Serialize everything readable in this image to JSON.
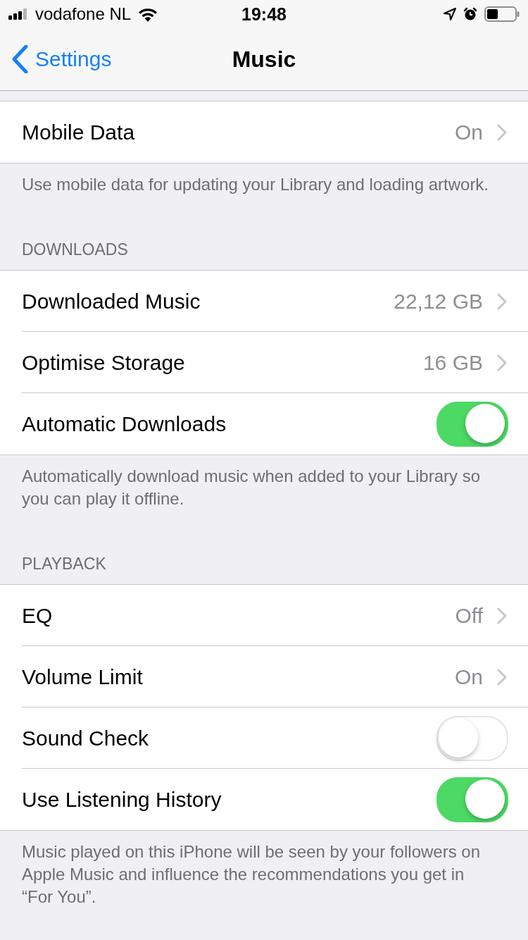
{
  "status_bar": {
    "carrier": "vodafone NL",
    "time": "19:48"
  },
  "nav": {
    "back": "Settings",
    "title": "Music"
  },
  "sections": [
    {
      "rows": [
        {
          "kind": "detail",
          "label": "Mobile Data",
          "value": "On"
        }
      ],
      "footer": "Use mobile data for updating your Library and loading artwork."
    },
    {
      "header": "DOWNLOADS",
      "rows": [
        {
          "kind": "detail",
          "label": "Downloaded Music",
          "value": "22,12 GB"
        },
        {
          "kind": "detail",
          "label": "Optimise Storage",
          "value": "16 GB"
        },
        {
          "kind": "toggle",
          "label": "Automatic Downloads",
          "on": true
        }
      ],
      "footer": "Automatically download music when added to your Library so you can play it offline."
    },
    {
      "header": "PLAYBACK",
      "rows": [
        {
          "kind": "detail",
          "label": "EQ",
          "value": "Off"
        },
        {
          "kind": "detail",
          "label": "Volume Limit",
          "value": "On"
        },
        {
          "kind": "toggle",
          "label": "Sound Check",
          "on": false
        },
        {
          "kind": "toggle",
          "label": "Use Listening History",
          "on": true
        }
      ],
      "footer": "Music played on this iPhone will be seen by your followers on Apple Music and influence the recommendations you get in “For You”."
    }
  ]
}
